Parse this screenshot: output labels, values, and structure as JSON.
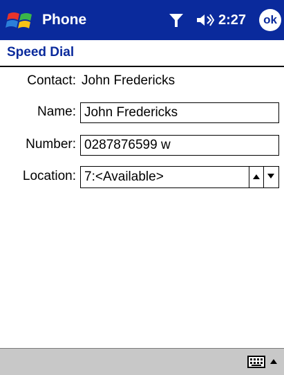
{
  "titlebar": {
    "app_title": "Phone",
    "time": "2:27",
    "ok_label": "ok",
    "bg_color": "#0a2a9c"
  },
  "page": {
    "section_title": "Speed Dial"
  },
  "form": {
    "contact_label": "Contact:",
    "contact_value": "John Fredericks",
    "name_label": "Name:",
    "name_value": "John Fredericks",
    "number_label": "Number:",
    "number_value": "0287876599 w",
    "location_label": "Location:",
    "location_value": "7:<Available>"
  },
  "icons": {
    "start": "windows-flag-icon",
    "signal": "signal-antenna-icon",
    "volume": "speaker-icon",
    "keyboard": "keyboard-icon",
    "input_arrow": "caret-up-icon"
  }
}
